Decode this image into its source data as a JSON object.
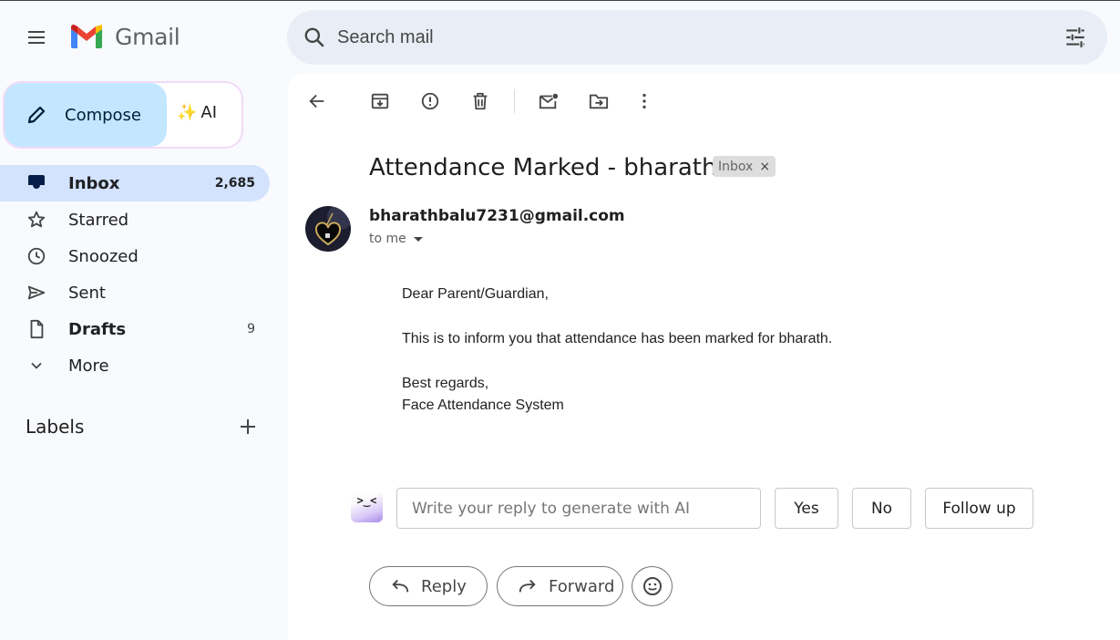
{
  "app": {
    "name": "Gmail"
  },
  "search": {
    "placeholder": "Search mail"
  },
  "compose": {
    "label": "Compose",
    "ai_label": "AI"
  },
  "sidebar": {
    "items": [
      {
        "label": "Inbox",
        "count": "2,685",
        "icon": "inbox-icon"
      },
      {
        "label": "Starred",
        "count": "",
        "icon": "star-icon"
      },
      {
        "label": "Snoozed",
        "count": "",
        "icon": "clock-icon"
      },
      {
        "label": "Sent",
        "count": "",
        "icon": "send-icon"
      },
      {
        "label": "Drafts",
        "count": "9",
        "icon": "draft-icon"
      },
      {
        "label": "More",
        "count": "",
        "icon": "chevron-down-icon"
      }
    ],
    "labels_heading": "Labels"
  },
  "email": {
    "subject": "Attendance Marked - bharath",
    "label_chip": "Inbox",
    "sender": "bharathbalu7231@gmail.com",
    "recipient": "to me",
    "body": [
      "Dear Parent/Guardian,",
      "This is to inform you that attendance has been marked for bharath.",
      "Best regards,",
      "Face Attendance System"
    ]
  },
  "ai_reply": {
    "placeholder": "Write your reply to generate with AI",
    "suggestions": [
      "Yes",
      "No",
      "Follow up"
    ]
  },
  "actions": {
    "reply": "Reply",
    "forward": "Forward"
  },
  "colors": {
    "active_nav": "#d3e3fd",
    "compose_bg": "#c2e7ff",
    "search_bg": "#e9eef6"
  }
}
